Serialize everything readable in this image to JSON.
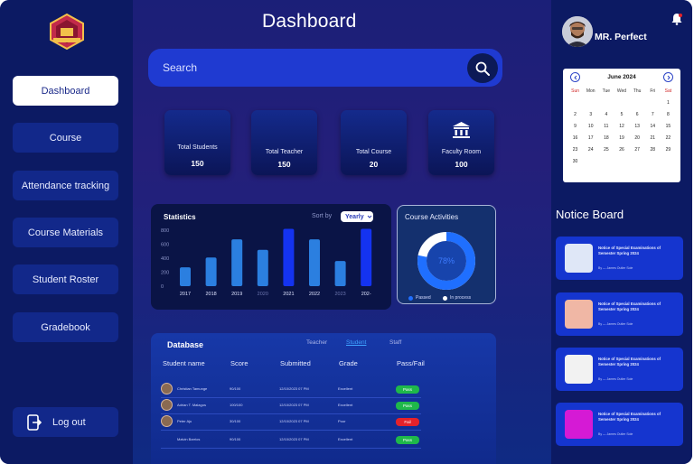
{
  "sidebar": {
    "items": [
      {
        "label": "Dashboard",
        "active": true
      },
      {
        "label": "Course"
      },
      {
        "label": "Attendance tracking"
      },
      {
        "label": "Course Materials"
      },
      {
        "label": "Student Roster"
      },
      {
        "label": "Gradebook"
      }
    ],
    "logout_label": "Log out"
  },
  "header": {
    "title": "Dashboard"
  },
  "search": {
    "placeholder": "Search"
  },
  "stats": [
    {
      "label": "Total Students",
      "value": "150"
    },
    {
      "label": "Total Teacher",
      "value": "150"
    },
    {
      "label": "Total Course",
      "value": "20"
    },
    {
      "label": "Faculty Room",
      "value": "100"
    }
  ],
  "statistics": {
    "title": "Statistics",
    "sort_by_label": "Sort by",
    "sort_value": "Yearly"
  },
  "chart_data": {
    "type": "bar",
    "title": "Statistics",
    "categories": [
      "2017",
      "2018",
      "2019",
      "2020",
      "2021",
      "2022",
      "2023",
      "202-"
    ],
    "values": [
      270,
      410,
      670,
      520,
      820,
      670,
      360,
      820
    ],
    "yticks": [
      "800",
      "600",
      "400",
      "200",
      "0"
    ],
    "ylim": [
      0,
      800
    ],
    "highlighted_categories": [
      "2021",
      "202-"
    ],
    "colors": {
      "normal": "#2b7fe0",
      "highlight": "#1433f0"
    }
  },
  "course_activities": {
    "title": "Course Activities",
    "percent": 78,
    "center_label": "78%",
    "legend": [
      {
        "label": "Passed",
        "color": "#1f6fff"
      },
      {
        "label": "In process",
        "color": "#ffffff"
      }
    ]
  },
  "database": {
    "title": "Database",
    "tabs": [
      {
        "label": "Teacher"
      },
      {
        "label": "Student",
        "active": true
      },
      {
        "label": "Staff"
      }
    ],
    "columns": [
      "Student name",
      "Score",
      "Submitted",
      "Grade",
      "Pass/Fail"
    ],
    "rows": [
      {
        "name": "Christian Tamunge",
        "score": "90/100",
        "submitted": "12/10/2023 07 PM",
        "grade": "Excellent",
        "status": "Pass",
        "status_color": "#1fb84a"
      },
      {
        "name": "Adrian T. Malagos",
        "score": "100/100",
        "submitted": "12/10/2023 07 PM",
        "grade": "Excellent",
        "status": "Pass",
        "status_color": "#1fb84a"
      },
      {
        "name": "Peter Aju",
        "score": "30/100",
        "submitted": "12/10/2023 07 PM",
        "grade": "Poor",
        "status": "Fail",
        "status_color": "#e5222a"
      },
      {
        "name": "Malvin Barrios",
        "score": "90/100",
        "submitted": "12/10/2023 07 PM",
        "grade": "Excellent",
        "status": "Pass",
        "status_color": "#1fb84a"
      }
    ]
  },
  "profile": {
    "name": "MR. Perfect"
  },
  "calendar": {
    "month": "June 2024",
    "days_of_week": [
      "Sun",
      "Mon",
      "Tue",
      "Wed",
      "Thu",
      "Fri",
      "Sat"
    ],
    "cells": [
      "",
      "",
      "",
      "",
      "",
      "",
      "1",
      "2",
      "3",
      "4",
      "5",
      "6",
      "7",
      "8",
      "9",
      "10",
      "11",
      "12",
      "13",
      "14",
      "15",
      "16",
      "17",
      "18",
      "19",
      "20",
      "21",
      "22",
      "23",
      "24",
      "25",
      "26",
      "27",
      "28",
      "29",
      "30",
      "",
      "",
      "",
      "",
      "",
      ""
    ]
  },
  "notice_board": {
    "title": "Notice Board",
    "items": [
      {
        "text": "Notice of Special Examinations of Semester Spring 2024",
        "by": "By — James Outler Sole",
        "img_color": "#dfe7f7"
      },
      {
        "text": "Notice of Special Examinations of Semester Spring 2024",
        "by": "By — James Outler Sole",
        "img_color": "#f0b7a5"
      },
      {
        "text": "Notice of Special Examinations of Semester Spring 2024",
        "by": "By — James Outler Sole",
        "img_color": "#f2f2f2"
      },
      {
        "text": "Notice of Special Examinations of Semester Spring 2024",
        "by": "By — James Outler Sole",
        "img_color": "#d51ad5"
      }
    ]
  }
}
